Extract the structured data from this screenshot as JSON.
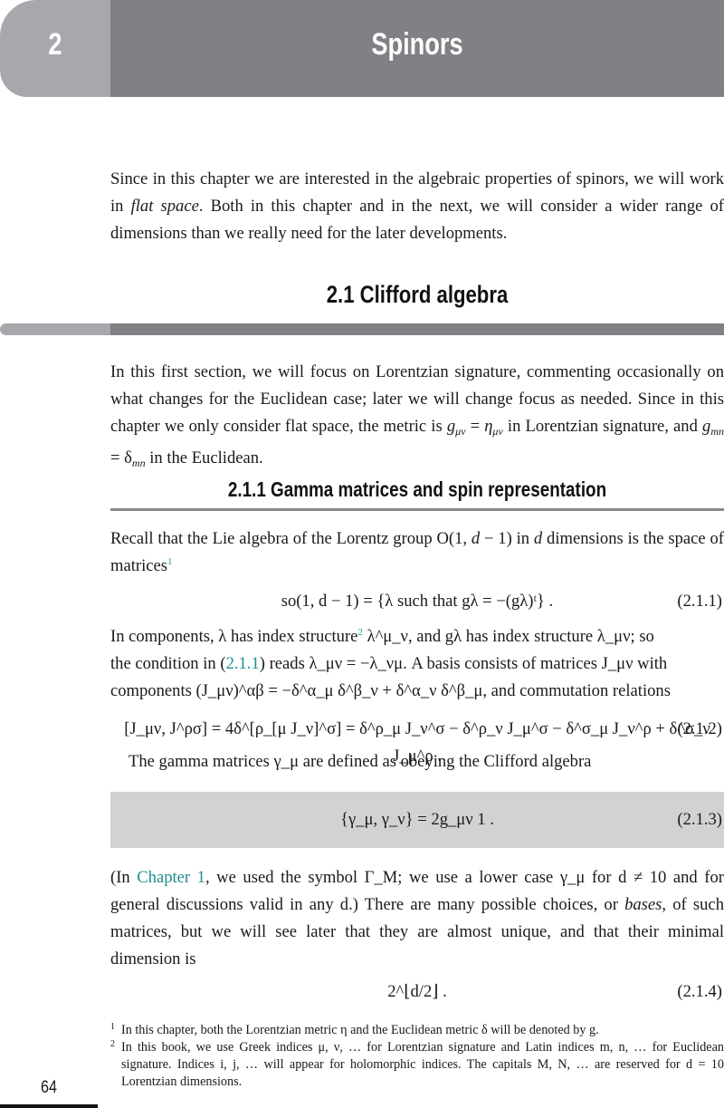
{
  "chapter": {
    "number": "2",
    "title": "Spinors"
  },
  "intro": {
    "text_before_italic": "Since in this chapter we are interested in the algebraic properties of spinors, we will work in ",
    "italic": "flat space",
    "text_after_italic": ". Both in this chapter and in the next, we will consider a wider range of dimensions than we really need for the later developments."
  },
  "section": {
    "heading": "2.1  Clifford algebra",
    "paragraph_1": {
      "part_a": "In this first section, we will focus on Lorentzian signature, commenting occasionally on what changes for the Euclidean case; later we will change focus as needed. Since in this chapter we only consider flat space, the metric is ",
      "math_a": "g",
      "math_a_sub": "μν",
      "eq_a": " = ",
      "math_b": "η",
      "math_b_sub": "μν",
      "part_b": " in Lorentzian signature, and ",
      "math_c": "g",
      "math_c_sub": "mn",
      "eq_b": " = δ",
      "math_d_sub": "mn",
      "part_c": " in the Euclidean."
    }
  },
  "subsection": {
    "heading": "2.1.1  Gamma matrices and spin representation",
    "paragraph_1": {
      "part_a": "Recall that the Lie algebra of the Lorentz group O(1, ",
      "d": "d",
      "part_b": " − 1) in ",
      "part_c": " dimensions is the space of matrices",
      "footnote_ref": "1"
    },
    "equation_1": {
      "body": "so(1, d − 1) = {λ such that gλ = −(gλ)ᵗ} .",
      "number": "(2.1.1)"
    },
    "paragraph_2": {
      "line_1": "In components, λ has index structure",
      "footnote_ref": "2",
      "line_1b": " λ^μ_ν, and gλ has index structure λ_μν; so",
      "line_2a": "the condition in (",
      "ref": "2.1.1",
      "line_2b": ") reads λ_μν = −λ_νμ. A basis consists of matrices J_μν with",
      "line_3": "components (J_μν)^αβ = −δ^α_μ δ^β_ν + δ^α_ν δ^β_μ, and commutation relations"
    },
    "equation_2": {
      "body": "[J_μν, J^ρσ] = 4δ^[ρ_[μ J_ν]^σ] = δ^ρ_μ J_ν^σ − δ^ρ_ν J_μ^σ − δ^σ_μ J_ν^ρ + δ^σ_ν J_μ^ρ .",
      "number": "(2.1.2)"
    },
    "paragraph_3": {
      "text": "The gamma matrices γ_μ are defined as obeying the Clifford algebra"
    },
    "equation_3": {
      "body": "{γ_μ, γ_ν} = 2g_μν 1 .",
      "number": "(2.1.3)"
    },
    "paragraph_4": {
      "part_a": "(In ",
      "link": "Chapter 1",
      "part_b": ", we used the symbol Γ_M; we use a lower case γ_μ for d ≠ 10 and for general discussions valid in any d.) There are many possible choices, or ",
      "italic": "bases",
      "part_c": ", of such matrices, but we will see later that they are almost unique, and that their minimal dimension is"
    },
    "equation_4": {
      "body": "2^⌊d/2⌋ .",
      "number": "(2.1.4)"
    }
  },
  "footnotes": [
    {
      "mark": "1",
      "text": "In this chapter, both the Lorentzian metric η and the Euclidean metric δ will be denoted by g."
    },
    {
      "mark": "2",
      "text": "In this book, we use Greek indices μ, ν, … for Lorentzian signature and Latin indices m, n, … for Euclidean signature. Indices i, j, … will appear for holomorphic indices. The capitals M, N, … are reserved for d = 10 Lorentzian dimensions."
    }
  ],
  "page_number": "64",
  "colors": {
    "banner_light": "#a7a8ac",
    "banner_dark": "#808185",
    "equation_box": "#d1d2d4",
    "link": "#1f8f8f"
  }
}
